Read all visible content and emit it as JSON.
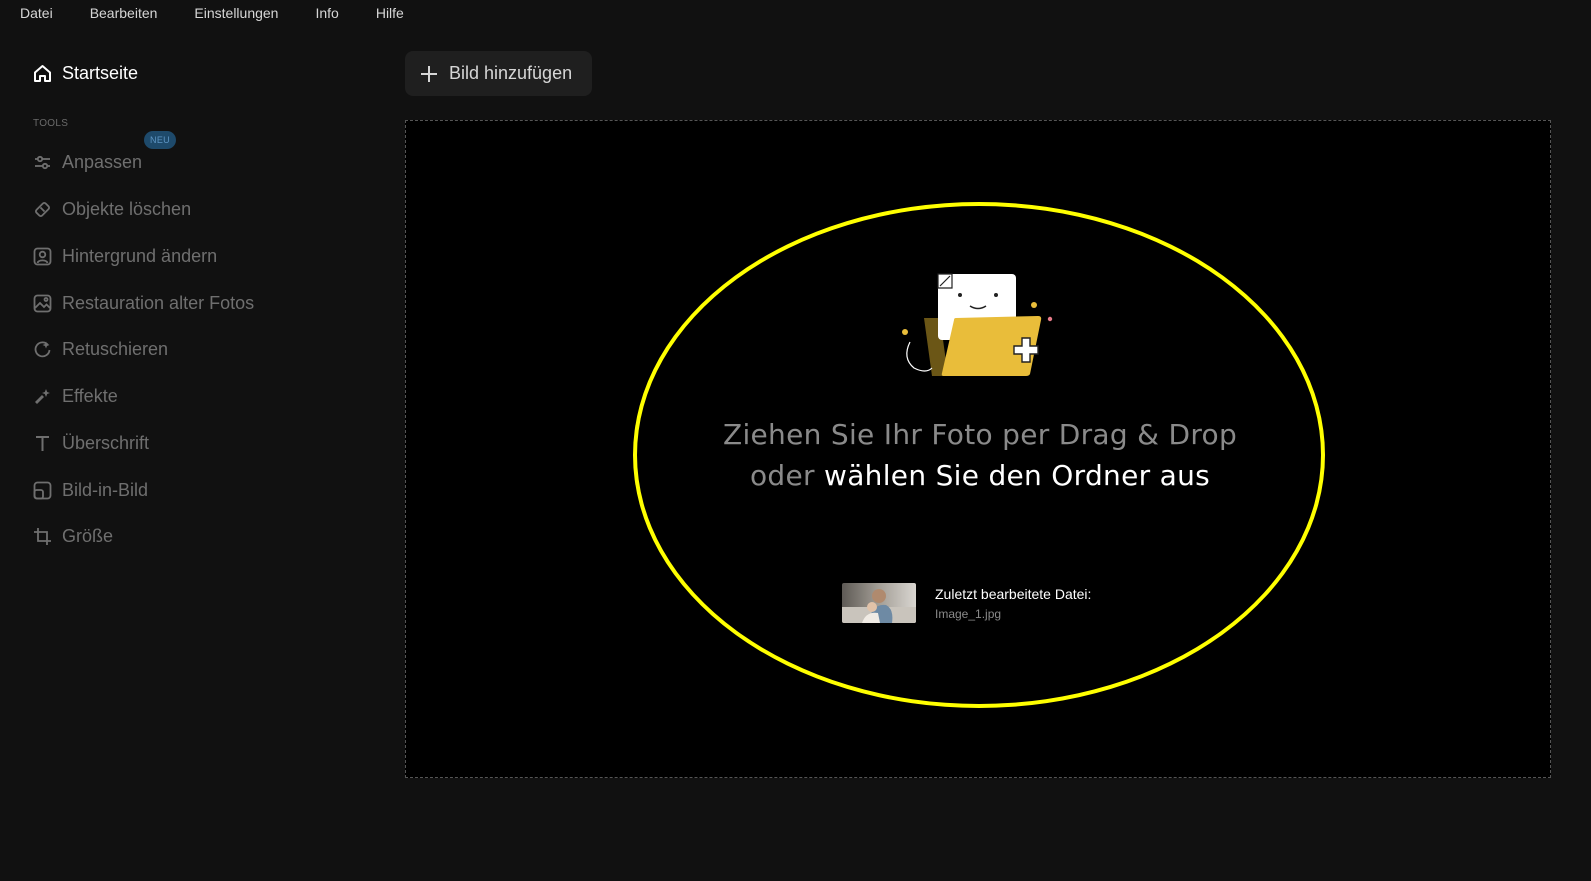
{
  "menubar": {
    "items": [
      "Datei",
      "Bearbeiten",
      "Einstellungen",
      "Info",
      "Hilfe"
    ]
  },
  "sidebar": {
    "home": {
      "label": "Startseite",
      "icon": "home-icon"
    },
    "section_label": "TOOLS",
    "badge": "NEU",
    "items": [
      {
        "label": "Anpassen",
        "icon": "sliders-icon"
      },
      {
        "label": "Objekte löschen",
        "icon": "eraser-icon"
      },
      {
        "label": "Hintergrund ändern",
        "icon": "portrait-icon"
      },
      {
        "label": "Restauration alter Fotos",
        "icon": "photo-restore-icon"
      },
      {
        "label": "Retuschieren",
        "icon": "retouch-icon"
      },
      {
        "label": "Effekte",
        "icon": "magic-wand-icon"
      },
      {
        "label": "Überschrift",
        "icon": "text-icon"
      },
      {
        "label": "Bild-in-Bild",
        "icon": "picture-in-picture-icon"
      },
      {
        "label": "Größe",
        "icon": "crop-icon"
      }
    ]
  },
  "toolbar": {
    "add_image_label": "Bild hinzufügen"
  },
  "dropzone": {
    "line1": "Ziehen Sie Ihr Foto per Drag & Drop",
    "or_text": "oder",
    "link_text": "wählen Sie den Ordner aus",
    "recent_title": "Zuletzt bearbeitete Datei:",
    "recent_file": "Image_1.jpg"
  },
  "colors": {
    "background": "#111111",
    "dropzone": "#000000",
    "highlight": "#ffff00",
    "folder": "#e9bd3a",
    "badge": "#1e4a6b"
  }
}
